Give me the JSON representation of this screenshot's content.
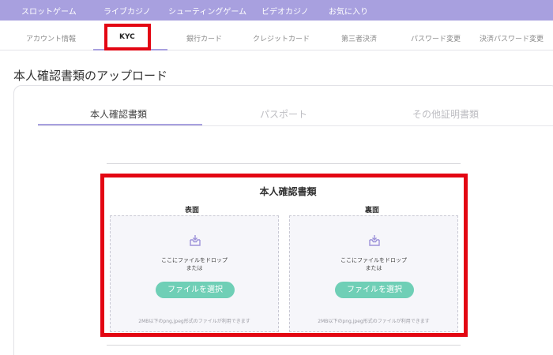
{
  "top_nav": {
    "items": [
      "スロットゲーム",
      "ライブカジノ",
      "シューティングゲーム",
      "ビデオカジノ",
      "お気に入り"
    ]
  },
  "account_tabs": {
    "items": [
      "アカウント情報",
      "KYC",
      "銀行カード",
      "クレジットカード",
      "第三者決済",
      "パスワード変更",
      "決済パスワード変更"
    ],
    "active": "KYC"
  },
  "page_title": "本人確認書類のアップロード",
  "document_tabs": {
    "items": [
      "本人確認書類",
      "パスポート",
      "その他証明書類"
    ],
    "active": "本人確認書類"
  },
  "upload": {
    "title": "本人確認書類",
    "front": {
      "label": "表面",
      "drop_text": "ここにファイルをドロップ",
      "or_text": "または",
      "button": "ファイルを選択",
      "note": "2MB以下のpng,jpeg形式のファイルが利用できます"
    },
    "back": {
      "label": "裏面",
      "drop_text": "ここにファイルをドロップ",
      "or_text": "または",
      "button": "ファイルを選択",
      "note": "2MB以下のpng,jpeg形式のファイルが利用できます"
    }
  },
  "colors": {
    "nav_background": "#a8a0df",
    "highlight_red": "#e30613",
    "button_green": "#6fcfb6",
    "icon_purple": "#9d93d9"
  },
  "icons": {
    "upload": "inbox-upload-icon"
  }
}
